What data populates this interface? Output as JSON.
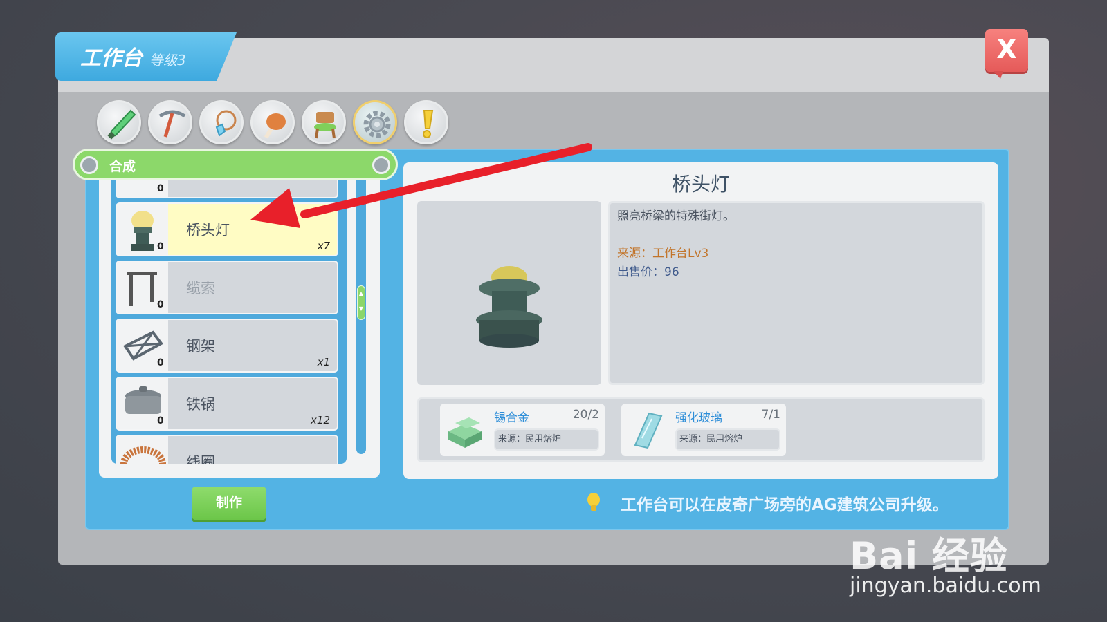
{
  "window": {
    "title": "工作台",
    "level": "等级3",
    "close_label": "X"
  },
  "categories": [
    {
      "icon": "sword-icon"
    },
    {
      "icon": "pickaxe-icon"
    },
    {
      "icon": "amulet-icon"
    },
    {
      "icon": "meat-icon"
    },
    {
      "icon": "chair-icon"
    },
    {
      "icon": "gear-icon",
      "active": true
    },
    {
      "icon": "exclamation-icon"
    }
  ],
  "synth": {
    "label": "合成"
  },
  "list": {
    "top_partial_count": "0",
    "items": [
      {
        "name": "桥头灯",
        "count": "0",
        "qty": "x7",
        "selected": true
      },
      {
        "name": "缆索",
        "count": "0",
        "qty": "",
        "disabled": true
      },
      {
        "name": "钢架",
        "count": "0",
        "qty": "x1"
      },
      {
        "name": "铁锅",
        "count": "0",
        "qty": "x12"
      },
      {
        "name": "线圈",
        "count": "",
        "qty": ""
      }
    ]
  },
  "make_button": "制作",
  "detail": {
    "title": "桥头灯",
    "description": "照亮桥梁的特殊街灯。",
    "source": "来源：工作台Lv3",
    "price": "出售价：96"
  },
  "materials": [
    {
      "name": "锡合金",
      "count": "20/2",
      "source": "来源：民用熔炉",
      "icon": "tin-alloy-icon"
    },
    {
      "name": "强化玻璃",
      "count": "7/1",
      "source": "来源：民用熔炉",
      "icon": "glass-icon"
    }
  ],
  "tip": "工作台可以在皮奇广场旁的AG建筑公司升级。",
  "watermark": {
    "logo": "Bai 经验",
    "url": "jingyan.baidu.com"
  },
  "colors": {
    "title_tab": "#3ea9df",
    "panel": "#53b3e4",
    "green": "#8cd86a",
    "close": "#e55a59",
    "arrow": "#e8202a"
  }
}
